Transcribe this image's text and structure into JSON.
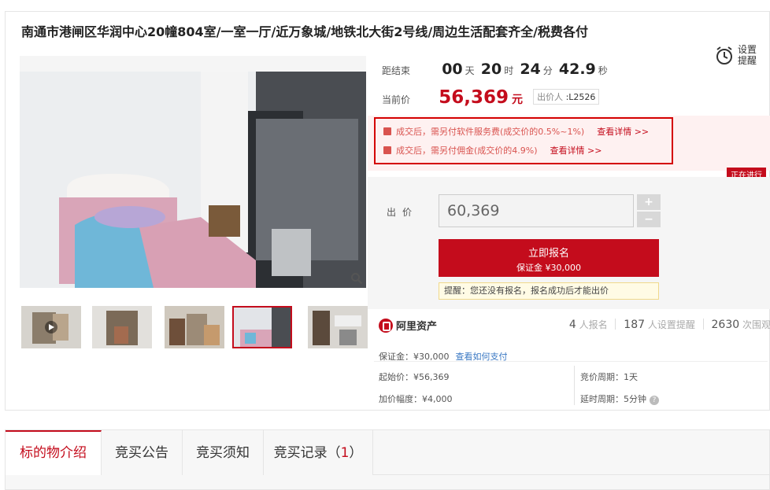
{
  "title": "南通市港闸区华润中心20幢804室/一室一厅/近万象城/地铁北大街2号线/周边生活配套齐全/税费各付",
  "countdown": {
    "label": "距结束",
    "days": "00",
    "days_unit": "天",
    "hours": "20",
    "hours_unit": "时",
    "minutes": "24",
    "minutes_unit": "分",
    "seconds": "42.9",
    "seconds_unit": "秒"
  },
  "remind": {
    "label_line1": "设置",
    "label_line2": "提醒",
    "icon": "alarm-clock-icon"
  },
  "current_price": {
    "label": "当前价",
    "value": "56,369",
    "unit": "元",
    "bidder_label": "出价人",
    "bidder": ":L2526"
  },
  "notices": [
    {
      "text": "成交后，需另付软件服务费(成交价的0.5%~1%)",
      "link": "查看详情 >>"
    },
    {
      "text": "成交后，需另付佣金(成交价的4.9%)",
      "link": "查看详情 >>"
    }
  ],
  "status_badge": "正在进行",
  "bid": {
    "label": "出价",
    "value": "60,369",
    "plus": "+",
    "minus": "−",
    "enroll_title": "立即报名",
    "enroll_deposit": "保证金 ¥30,000",
    "tip": "提醒：您还没有报名，报名成功后才能出价"
  },
  "brand": "阿里资产",
  "stats": {
    "signups": "4",
    "signups_label": "人报名",
    "reminders": "187",
    "reminders_label": "人设置提醒",
    "views": "2630",
    "views_label": "次围观"
  },
  "details": {
    "deposit": "保证金：¥30,000",
    "deposit_link": "查看如何支付",
    "start_price": "起始价：¥56,369",
    "increment": "加价幅度：¥4,000",
    "period": "竞价周期：1天",
    "delay": "延时周期：5分钟",
    "help": "?"
  },
  "tabs": [
    {
      "label": "标的物介绍"
    },
    {
      "label": "竞买公告"
    },
    {
      "label": "竞买须知"
    },
    {
      "label": "竞买记录（",
      "count": "1",
      "suffix": "）"
    }
  ],
  "colors": {
    "accent": "#c40c1c",
    "notice": "#d9534f",
    "link": "#3a78c3"
  }
}
